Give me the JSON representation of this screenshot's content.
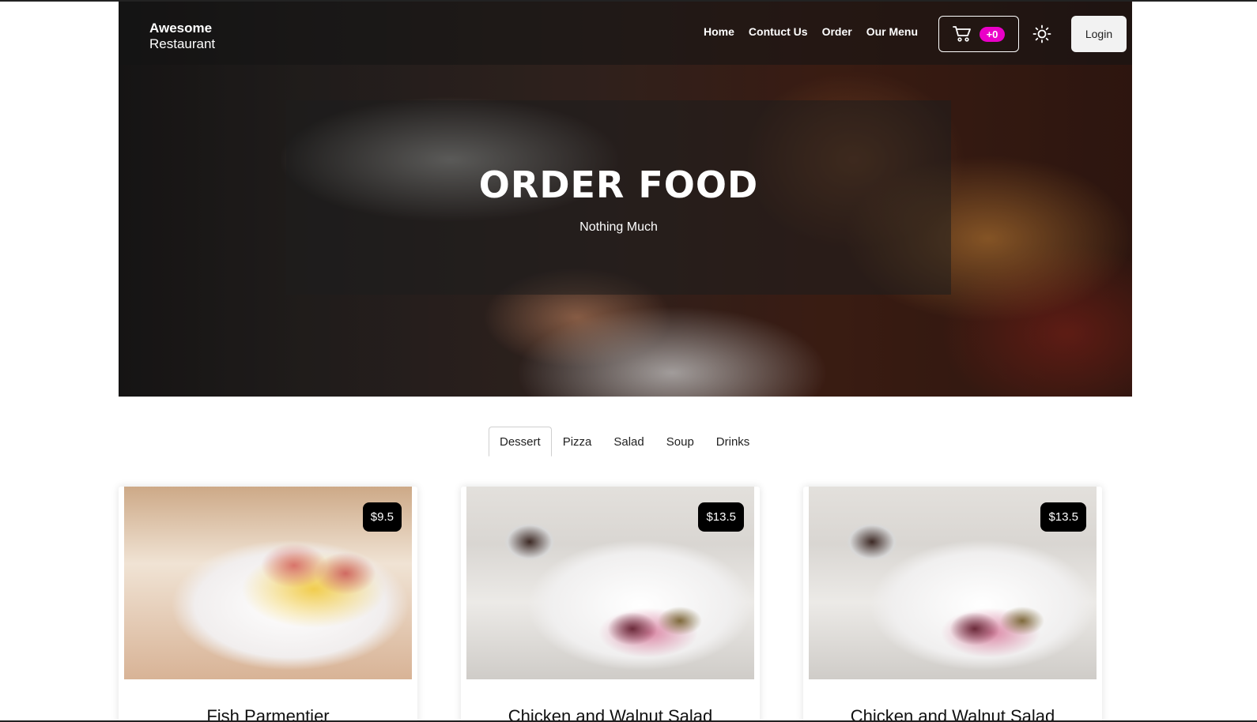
{
  "brand": {
    "line1": "Awesome",
    "line2": "Restaurant"
  },
  "nav": {
    "links": [
      "Home",
      "Contuct Us",
      "Order",
      "Our Menu"
    ],
    "cart_count": "+0",
    "login_label": "Login"
  },
  "hero": {
    "title": "ORDER FOOD",
    "subtitle": "Nothing Much"
  },
  "tabs": {
    "items": [
      "Dessert",
      "Pizza",
      "Salad",
      "Soup",
      "Drinks"
    ],
    "active": "Dessert"
  },
  "cards": [
    {
      "title": "Fish Parmentier",
      "price": "$9.5"
    },
    {
      "title": "Chicken and Walnut Salad",
      "price": "$13.5"
    },
    {
      "title": "Chicken and Walnut Salad",
      "price": "$13.5"
    }
  ],
  "colors": {
    "cart_badge": "#ea00c8",
    "price_badge": "#000000",
    "nav_text": "#ffffff"
  },
  "icons": {
    "cart": "cart-icon",
    "theme": "sun-icon"
  }
}
